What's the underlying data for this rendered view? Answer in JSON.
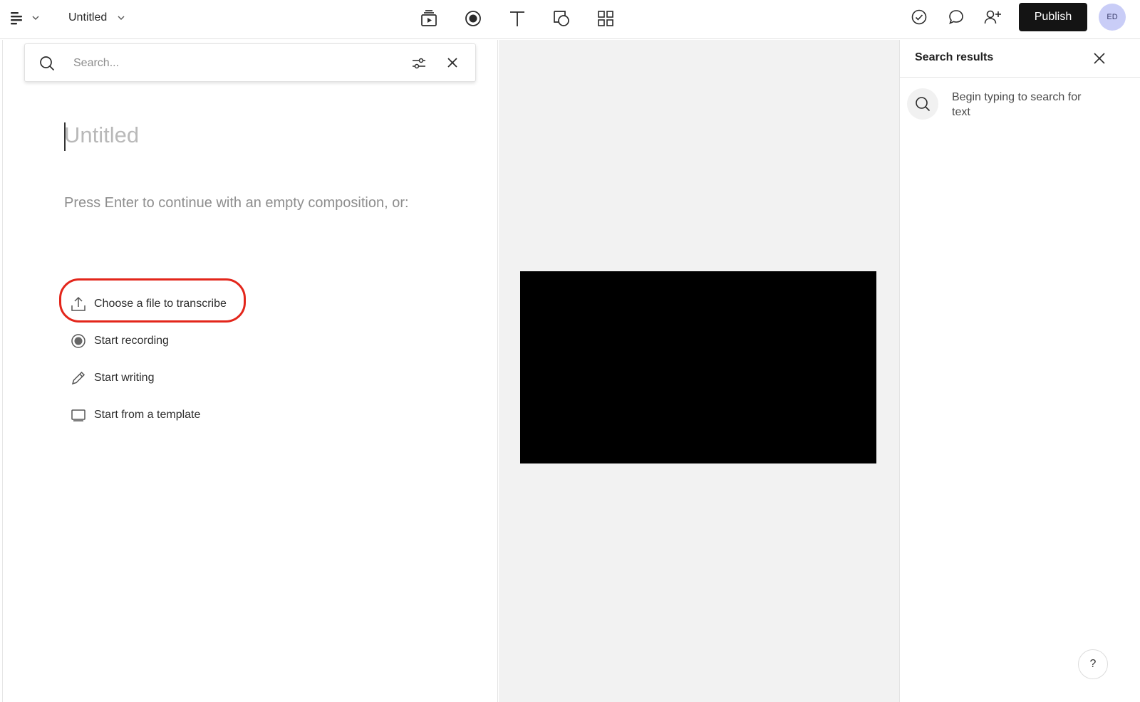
{
  "header": {
    "doc_title": "Untitled",
    "publish_label": "Publish",
    "avatar_initials": "ED",
    "tools": [
      "scenes-icon",
      "record-icon",
      "text-icon",
      "shapes-icon",
      "grid-icon"
    ],
    "actions": [
      "check-circle-icon",
      "comment-icon",
      "add-user-icon"
    ]
  },
  "search": {
    "placeholder": "Search...",
    "value": ""
  },
  "editor": {
    "heading_placeholder": "Untitled",
    "hint": "Press Enter to continue with an empty composition, or:",
    "options": [
      {
        "label": "Choose a file to transcribe",
        "icon": "upload-icon",
        "highlighted": true
      },
      {
        "label": "Start recording",
        "icon": "record-icon"
      },
      {
        "label": "Start writing",
        "icon": "pencil-icon"
      },
      {
        "label": "Start from a template",
        "icon": "template-icon"
      }
    ]
  },
  "search_results": {
    "title": "Search results",
    "empty_text": "Begin typing to search for text"
  },
  "help": {
    "label": "?"
  },
  "colors": {
    "publish_bg": "#141414",
    "avatar_bg": "#c9cdf7",
    "highlight_ring": "#e3261b",
    "canvas_bg": "#f2f2f2",
    "video_frame": "#000000"
  }
}
